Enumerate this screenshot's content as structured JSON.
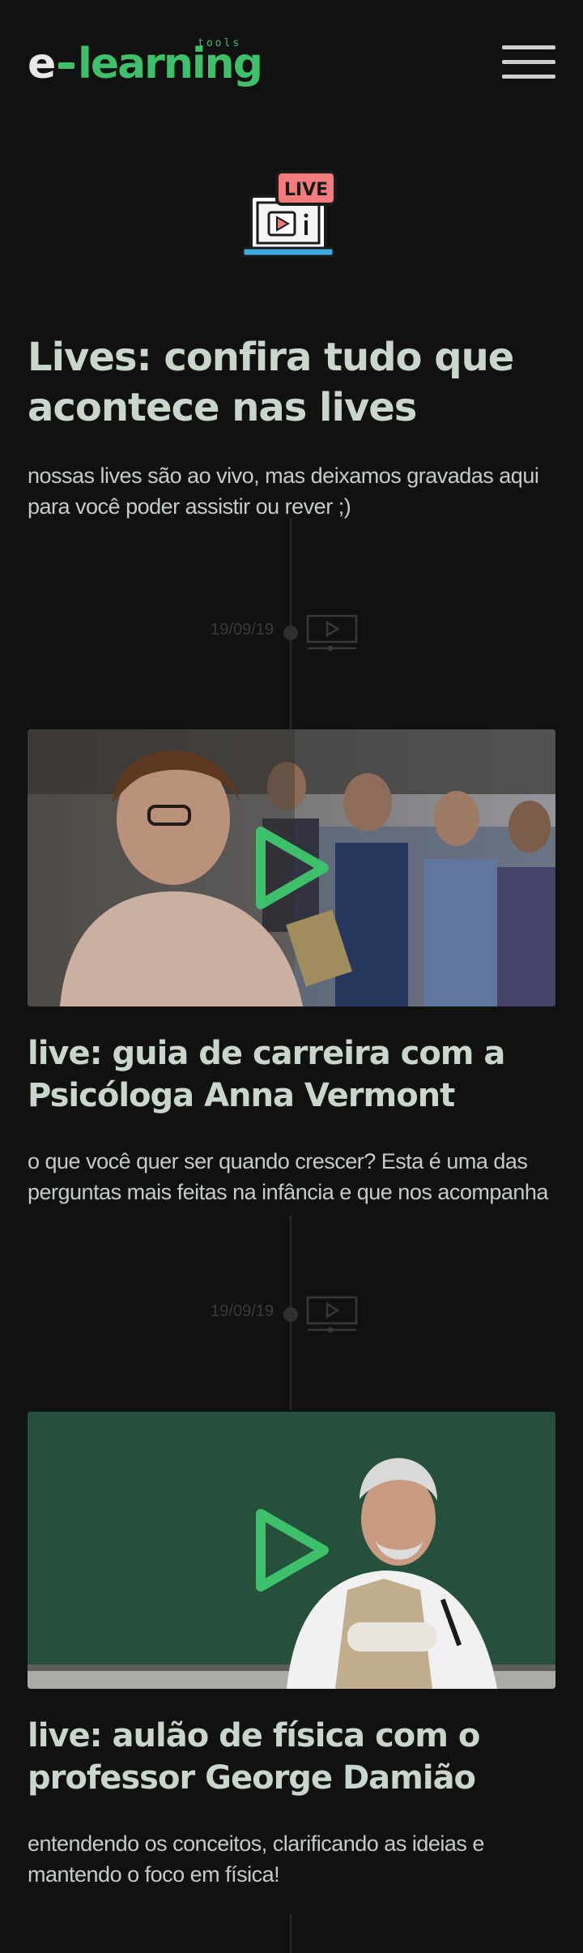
{
  "header": {
    "logo_e": "e",
    "logo_learning": "learning",
    "logo_tools": "tools"
  },
  "icons": {
    "hero": "live-laptop-icon",
    "menu": "hamburger-menu-icon",
    "timeline": "video-player-icon",
    "play": "play-icon"
  },
  "hero": {
    "badge": "LIVE",
    "title": "Lives: confira tudo que acontece nas lives",
    "subtitle": "nossas lives são ao vivo, mas deixamos gravadas aqui para você poder assistir ou rever ;)"
  },
  "lives": [
    {
      "date": "19/09/19",
      "title": "live: guia de carreira com a Psicóloga Anna Vermont",
      "description": "o que você quer ser quando crescer? Esta é uma das perguntas mais feitas na infância e que nos acompanha"
    },
    {
      "date": "19/09/19",
      "title": "live: aulão de física com o professor George Damião",
      "description": "entendendo os conceitos, clarificando as ideias e mantendo o foco em física!"
    }
  ],
  "colors": {
    "background": "#111111",
    "accent": "#3ec06a",
    "text": "#c9d6cc",
    "live_badge": "#f47b7b"
  }
}
